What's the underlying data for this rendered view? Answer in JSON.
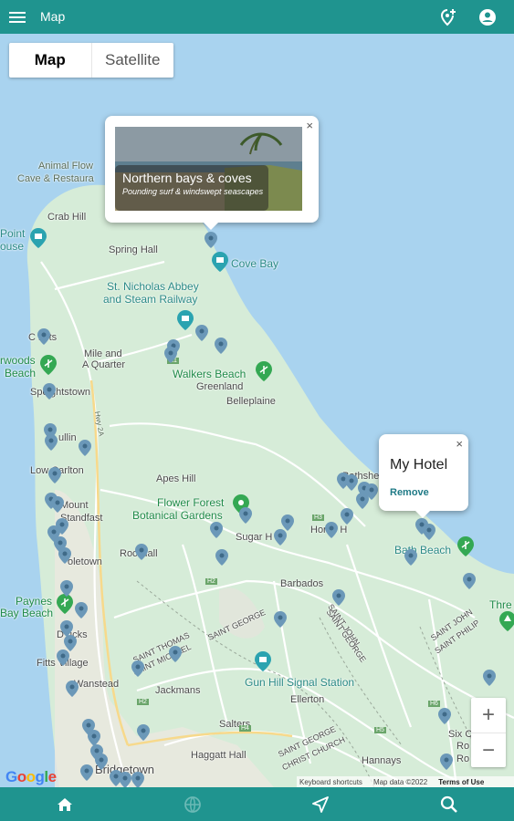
{
  "app_bar": {
    "title": "Map",
    "icons": [
      "menu-icon",
      "add-location-icon",
      "account-icon"
    ]
  },
  "map_type": {
    "map_label": "Map",
    "satellite_label": "Satellite",
    "selected": "Map"
  },
  "info_windows": {
    "photo": {
      "title": "Northern bays & coves",
      "subtitle": "Pounding surf & windswept seascapes",
      "close": "×"
    },
    "hotel": {
      "title": "My Hotel",
      "action": "Remove",
      "close": "×"
    }
  },
  "places": {
    "animal_flower_1": "Animal Flow",
    "animal_flower_2": "Cave & Restaura",
    "crab_hill": "Crab Hill",
    "point_1": "Point",
    "point_2": "ouse",
    "spring_hall": "Spring Hall",
    "cove_bay": "Cove Bay",
    "st_nicholas_1": "St. Nicholas Abbey",
    "st_nicholas_2": "and Steam Railway",
    "cketts": "C kets",
    "mile_1": "Mile and",
    "mile_2": "A Quarter",
    "woods_1": "rwoods",
    "woods_2": "Beach",
    "walkers": "Walkers Beach",
    "greenland": "Greenland",
    "speightstown": "Speightstown",
    "belleplaine": "Belleplaine",
    "ullin": "ullin",
    "carlton": "Low  Carlton",
    "apes_hill": "Apes Hill",
    "bathsheba": "Bathshe",
    "flower_1": "Flower Forest",
    "flower_2": "Botanical Gardens",
    "mount_1": "Mount",
    "mount_2": "Standfast",
    "sugar_hill": "Sugar H",
    "horse_hill": "Horse H",
    "bath_beach": "Bath Beach",
    "holetown": "oletown",
    "rock_hall": "Roc  Hall",
    "barbados": "Barbados",
    "paynes_1": "Paynes",
    "paynes_2": "Bay Beach",
    "thre": "Thre",
    "derricks": "D  ricks",
    "st_thomas": "SAINT THOMAS",
    "st_michael": "SAINT MICHAEL",
    "st_george_a": "SAINT GEORGE",
    "st_john": "SAINT JOHN",
    "st_george_b": "SAINT GEORGE",
    "st_john_2": "SAINT JOHN",
    "st_philip": "SAINT PHILIP",
    "fitts": "Fitts Village",
    "jackmans": "Jackmans",
    "gun_hill": "Gun Hill Signal Station",
    "wanstead": "Wanstead",
    "ellerton": "Ellerton",
    "salters": "Salters",
    "sg_cc_1": "SAINT GEORGE",
    "sg_cc_2": "CHRIST CHURCH",
    "six_cross": "Six C",
    "roads_1": "Ro",
    "roads_2": "Ro",
    "haggatt": "Haggatt Hall",
    "hannays": "Hannays",
    "bridgetown": "Bridgetown",
    "hwy_h1": "H1",
    "hwy_h2a": "H2",
    "hwy_h2b": "H2",
    "hwy_h3": "H3",
    "hwy_h4": "H4",
    "hwy_h5": "H5",
    "hwy_h6": "H6",
    "road_2a": "Hwy 2A"
  },
  "zoom": {
    "in": "+",
    "out": "−"
  },
  "google_logo": "Google",
  "attribution": {
    "shortcuts": "Keyboard shortcuts",
    "data": "Map data ©2022",
    "terms": "Terms of Use"
  },
  "bottom_nav": [
    "home-icon",
    "globe-icon",
    "navigation-icon",
    "search-icon"
  ],
  "colors": {
    "app_bar": "#1f948f",
    "land": "#d6ecd8",
    "sea": "#a9d3ef",
    "pin": "#6b98b8",
    "poi_teal": "#2ba3b0",
    "poi_green": "#34a853"
  }
}
